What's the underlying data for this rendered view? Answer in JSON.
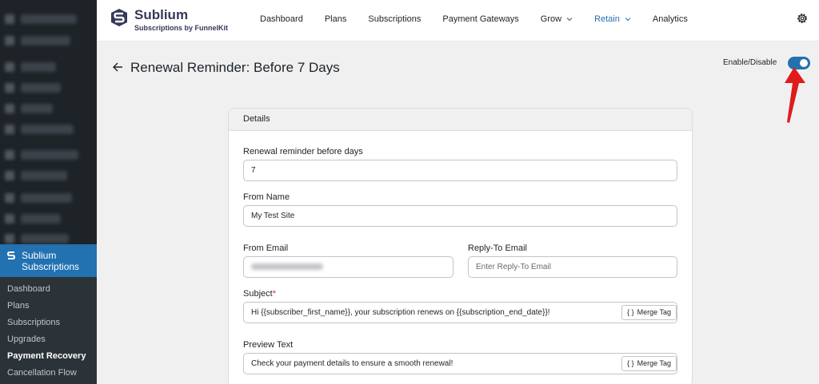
{
  "sidebar": {
    "plugin_label": "Sublium Subscriptions",
    "submenu": [
      {
        "label": "Dashboard",
        "active": false
      },
      {
        "label": "Plans",
        "active": false
      },
      {
        "label": "Subscriptions",
        "active": false
      },
      {
        "label": "Upgrades",
        "active": false
      },
      {
        "label": "Payment Recovery",
        "active": true
      },
      {
        "label": "Cancellation Flow",
        "active": false
      }
    ]
  },
  "header": {
    "brand_name": "Sublium",
    "brand_tagline": "Subscriptions by FunnelKit",
    "nav": [
      "Dashboard",
      "Plans",
      "Subscriptions",
      "Payment Gateways",
      "Grow",
      "Retain",
      "Analytics"
    ],
    "active_nav": "Retain",
    "icons": [
      "chevron-down-icon",
      "gear-icon"
    ]
  },
  "page": {
    "title": "Renewal Reminder: Before 7 Days",
    "toggle_label": "Enable/Disable",
    "toggle_on": true
  },
  "form": {
    "section_title": "Details",
    "renewal_days_label": "Renewal reminder before days",
    "renewal_days_value": "7",
    "from_name_label": "From Name",
    "from_name_value": "My Test Site",
    "from_email_label": "From Email",
    "reply_to_label": "Reply-To Email",
    "reply_to_placeholder": "Enter Reply-To Email",
    "subject_label": "Subject",
    "subject_required": "*",
    "subject_value": "Hi {{subscriber_first_name}}, your subscription renews on {{subscription_end_date}}!",
    "preview_label": "Preview Text",
    "preview_value": "Check your payment details to ensure a smooth renewal!",
    "merge_tag_label": "Merge Tag",
    "merge_tag_brace": "{ }"
  },
  "colors": {
    "accent": "#2271b1",
    "annotation": "#e01b1b",
    "sidebar_bg": "#1d2327"
  }
}
